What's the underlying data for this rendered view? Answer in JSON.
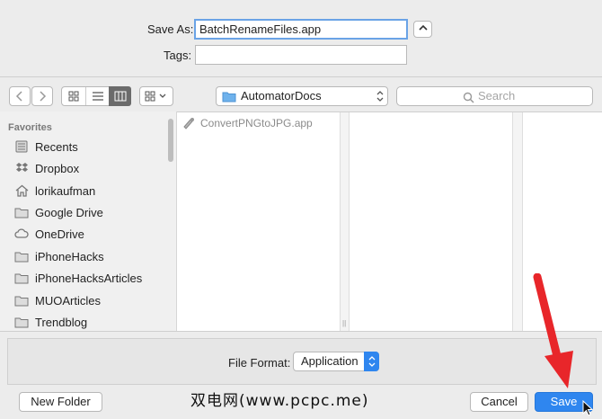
{
  "save_as": {
    "label": "Save As:",
    "value": "BatchRenameFiles.app"
  },
  "tags": {
    "label": "Tags:",
    "value": ""
  },
  "toolbar": {
    "location": "AutomatorDocs",
    "search_placeholder": "Search"
  },
  "sidebar": {
    "heading": "Favorites",
    "items": [
      {
        "label": "Recents",
        "icon": "recents-icon"
      },
      {
        "label": "Dropbox",
        "icon": "dropbox-icon"
      },
      {
        "label": "lorikaufman",
        "icon": "home-icon"
      },
      {
        "label": "Google Drive",
        "icon": "folder-icon"
      },
      {
        "label": "OneDrive",
        "icon": "cloud-icon"
      },
      {
        "label": "iPhoneHacks",
        "icon": "folder-icon"
      },
      {
        "label": "iPhoneHacksArticles",
        "icon": "folder-icon"
      },
      {
        "label": "MUOArticles",
        "icon": "folder-icon"
      },
      {
        "label": "Trendblog",
        "icon": "folder-icon"
      }
    ]
  },
  "files": [
    {
      "name": "ConvertPNGtoJPG.app",
      "icon": "automator-app-icon"
    }
  ],
  "file_format": {
    "label": "File Format:",
    "value": "Application"
  },
  "buttons": {
    "new_folder": "New Folder",
    "cancel": "Cancel",
    "save": "Save"
  },
  "watermark": "双电网(www.pcpc.me)",
  "colors": {
    "accent": "#2f86ef",
    "arrow": "#e8262a"
  }
}
